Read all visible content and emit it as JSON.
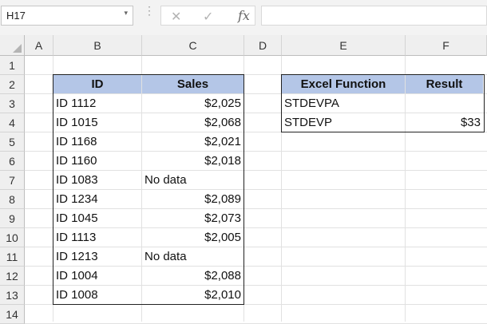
{
  "formula_bar": {
    "name_box": "H17",
    "dropdown_glyph": "▾",
    "separator_glyph": "⋮",
    "cancel_glyph": "✕",
    "enter_glyph": "✓",
    "fx_label": "fx",
    "formula": ""
  },
  "columns": [
    "A",
    "B",
    "C",
    "D",
    "E",
    "F"
  ],
  "rows": [
    "1",
    "2",
    "3",
    "4",
    "5",
    "6",
    "7",
    "8",
    "9",
    "10",
    "11",
    "12",
    "13",
    "14"
  ],
  "sales_table": {
    "headers": [
      "ID",
      "Sales"
    ],
    "rows": [
      [
        "ID 1112",
        "$2,025"
      ],
      [
        "ID 1015",
        "$2,068"
      ],
      [
        "ID 1168",
        "$2,021"
      ],
      [
        "ID 1160",
        "$2,018"
      ],
      [
        "ID 1083",
        "No data"
      ],
      [
        "ID 1234",
        "$2,089"
      ],
      [
        "ID 1045",
        "$2,073"
      ],
      [
        "ID 1113",
        "$2,005"
      ],
      [
        "ID 1213",
        "No data"
      ],
      [
        "ID 1004",
        "$2,088"
      ],
      [
        "ID 1008",
        "$2,010"
      ]
    ]
  },
  "function_table": {
    "headers": [
      "Excel Function",
      "Result"
    ],
    "rows": [
      [
        "STDEVPA",
        ""
      ],
      [
        "STDEVP",
        "$33"
      ]
    ]
  },
  "colors": {
    "header_fill": "#b4c6e7",
    "grid_line": "#e1e1e1",
    "header_bg": "#efefef"
  }
}
